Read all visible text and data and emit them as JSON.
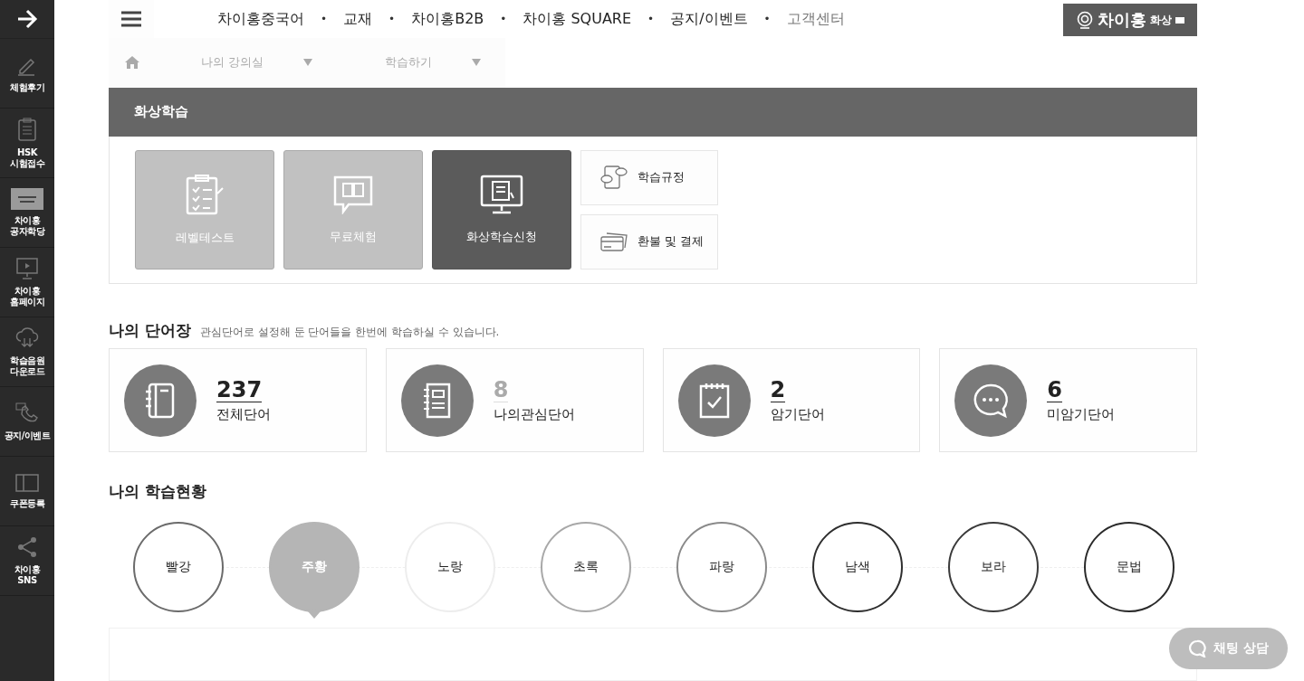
{
  "sidebar": {
    "items": [
      {
        "label": "체험후기",
        "kind": "pencil"
      },
      {
        "label": "HSK\n시험접수",
        "kind": "clipboard"
      },
      {
        "label": "차이홍\n공자학당",
        "kind": "plaque"
      },
      {
        "label": "차이홍\n홈페이지",
        "kind": "monitor"
      },
      {
        "label": "학습음원\n다운로드",
        "kind": "cloud"
      },
      {
        "label": "공지/이벤트",
        "kind": "phone"
      },
      {
        "label": "쿠폰등록",
        "kind": "coupon"
      },
      {
        "label": "차이홍\nSNS",
        "kind": "share"
      }
    ]
  },
  "top_nav": {
    "items": [
      {
        "label": "차이홍중국어",
        "dimmed": false
      },
      {
        "label": "교재",
        "dimmed": false
      },
      {
        "label": "차이홍B2B",
        "dimmed": false
      },
      {
        "label": "차이홍 SQUARE",
        "dimmed": false
      },
      {
        "label": "공지/이벤트",
        "dimmed": false
      },
      {
        "label": "고객센터",
        "dimmed": true
      }
    ],
    "separator": "•"
  },
  "logo": {
    "brand": "차이홍",
    "sub": "화상"
  },
  "breadcrumb": {
    "items": [
      "나의 강의실",
      "학습하기"
    ]
  },
  "video_panel": {
    "title": "화상학습",
    "tiles": [
      {
        "label": "레벨테스트",
        "kind": "test",
        "selected": false
      },
      {
        "label": "무료체험",
        "kind": "book",
        "selected": false
      },
      {
        "label": "화상학습신청",
        "kind": "monitor",
        "selected": true
      }
    ],
    "links": [
      {
        "label": "학습규정",
        "kind": "chat"
      },
      {
        "label": "환불 및 결제",
        "kind": "card"
      }
    ]
  },
  "vocab": {
    "title": "나의 단어장",
    "subtitle": "관심단어로 설정해 둔 단어들을 한번에 학습하실 수 있습니다.",
    "cards": [
      {
        "count": "237",
        "label": "전체단어",
        "kind": "notebook",
        "dimmed": false
      },
      {
        "count": "8",
        "label": "나의관심단어",
        "kind": "notepad",
        "dimmed": true
      },
      {
        "count": "2",
        "label": "암기단어",
        "kind": "check",
        "dimmed": false
      },
      {
        "count": "6",
        "label": "미암기단어",
        "kind": "bubble",
        "dimmed": false
      }
    ]
  },
  "progress": {
    "title": "나의 학습현황",
    "levels": [
      {
        "label": "빨강",
        "color": "#6b6b6b",
        "selected": false
      },
      {
        "label": "주황",
        "color": "#b5b5b5",
        "selected": true
      },
      {
        "label": "노랑",
        "color": "#ededed",
        "selected": false
      },
      {
        "label": "초록",
        "color": "#a8a8a8",
        "selected": false
      },
      {
        "label": "파랑",
        "color": "#8a8a8a",
        "selected": false
      },
      {
        "label": "남색",
        "color": "#2e2e2e",
        "selected": false
      },
      {
        "label": "보라",
        "color": "#3a3a3a",
        "selected": false
      },
      {
        "label": "문법",
        "color": "#2a2a2a",
        "selected": false
      }
    ]
  },
  "chat_button": {
    "label": "채팅 상담"
  }
}
